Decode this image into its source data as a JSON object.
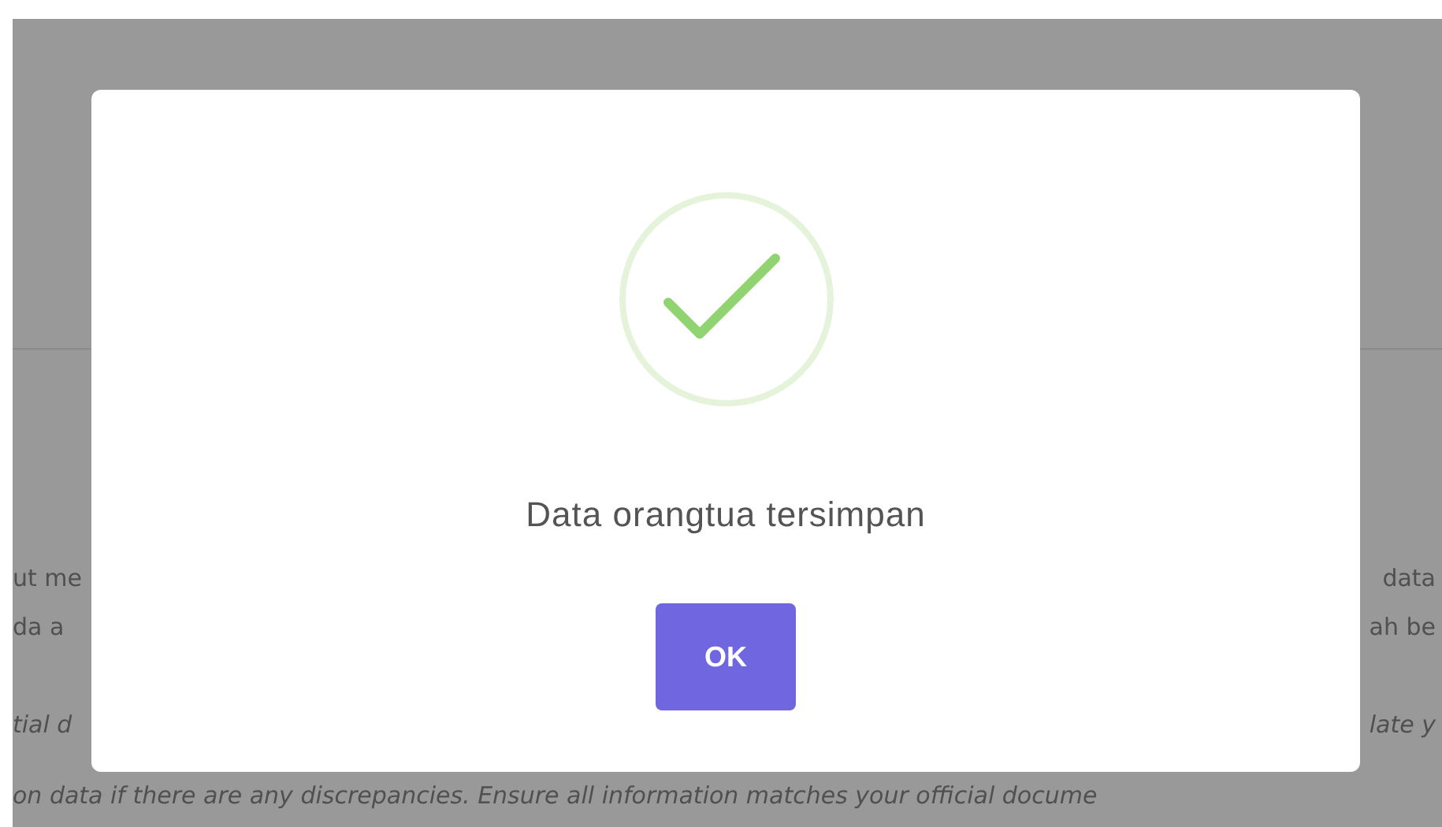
{
  "background": {
    "lines": [
      {
        "left": "ut me",
        "right": "data",
        "italic": false
      },
      {
        "left": "da a",
        "right": "ah be",
        "italic": false
      },
      {
        "left": "tial d",
        "right": "late y",
        "italic": true
      },
      {
        "left": "on data if there are any discrepancies. Ensure all information matches your official docume",
        "italic": true
      }
    ]
  },
  "dialog": {
    "message": "Data orangtua tersimpan",
    "button": "OK"
  }
}
